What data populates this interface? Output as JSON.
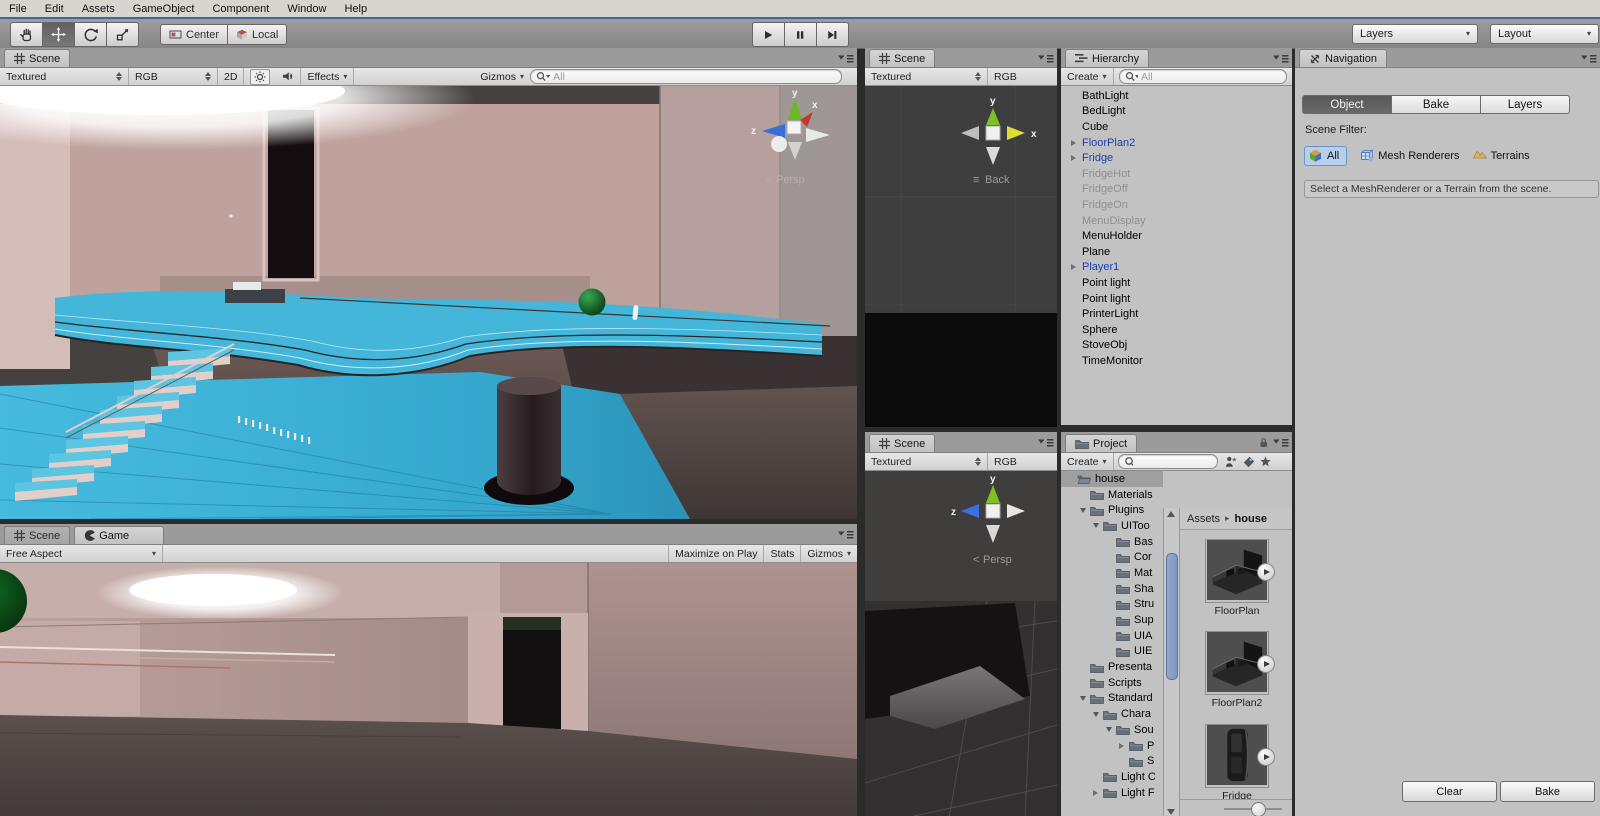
{
  "menu": {
    "items": [
      "File",
      "Edit",
      "Assets",
      "GameObject",
      "Component",
      "Window",
      "Help"
    ]
  },
  "toolbar": {
    "center": "Center",
    "local": "Local",
    "layers": "Layers",
    "layout": "Layout"
  },
  "scene_main": {
    "tab": "Scene",
    "shading": "Textured",
    "channel": "RGB",
    "btn_2d": "2D",
    "effects": "Effects",
    "gizmos": "Gizmos",
    "search_placeholder": "All",
    "view_label": "Persp",
    "view_icon": "<",
    "axis": {
      "x": "x",
      "y": "y",
      "z": "z"
    }
  },
  "scene_back": {
    "tab": "Scene",
    "shading": "Textured",
    "channel": "RGB",
    "view_label": "Back",
    "view_icon": "≡",
    "axis": {
      "x": "x",
      "y": "y"
    }
  },
  "scene_persp": {
    "tab": "Scene",
    "shading": "Textured",
    "channel": "RGB",
    "view_label": "Persp",
    "view_icon": "<",
    "axis": {
      "y": "y",
      "z": "z"
    }
  },
  "game": {
    "tab_scene": "Scene",
    "tab_game": "Game",
    "aspect": "Free Aspect",
    "maximize": "Maximize on Play",
    "stats": "Stats",
    "gizmos": "Gizmos"
  },
  "hierarchy": {
    "tab": "Hierarchy",
    "create": "Create",
    "search_placeholder": "All",
    "items": [
      {
        "label": "BathLight",
        "state": "normal"
      },
      {
        "label": "BedLight",
        "state": "normal"
      },
      {
        "label": "Cube",
        "state": "normal"
      },
      {
        "label": "FloorPlan2",
        "state": "prefab",
        "expand": true
      },
      {
        "label": "Fridge",
        "state": "prefab",
        "expand": true
      },
      {
        "label": "FridgeHot",
        "state": "disabled"
      },
      {
        "label": "FridgeOff",
        "state": "disabled"
      },
      {
        "label": "FridgeOn",
        "state": "disabled"
      },
      {
        "label": "MenuDisplay",
        "state": "disabled"
      },
      {
        "label": "MenuHolder",
        "state": "normal"
      },
      {
        "label": "Plane",
        "state": "normal"
      },
      {
        "label": "Player1",
        "state": "prefab",
        "expand": true
      },
      {
        "label": "Point light",
        "state": "normal"
      },
      {
        "label": "Point light",
        "state": "normal"
      },
      {
        "label": "PrinterLight",
        "state": "normal"
      },
      {
        "label": "Sphere",
        "state": "normal"
      },
      {
        "label": "StoveObj",
        "state": "normal"
      },
      {
        "label": "TimeMonitor",
        "state": "normal"
      }
    ]
  },
  "project": {
    "tab": "Project",
    "create": "Create",
    "search_placeholder": "",
    "breadcrumb": {
      "root": "Assets",
      "sep": "▸",
      "current": "house"
    },
    "tree": [
      {
        "label": "house",
        "indent": 0,
        "folder": "open",
        "selected": true
      },
      {
        "label": "Materials",
        "indent": 1,
        "folder": "closed"
      },
      {
        "label": "Plugins",
        "indent": 1,
        "folder": "closed",
        "arrow": "open"
      },
      {
        "label": "UIToo",
        "indent": 2,
        "folder": "closed",
        "arrow": "open"
      },
      {
        "label": "Bas",
        "indent": 3,
        "folder": "closed"
      },
      {
        "label": "Cor",
        "indent": 3,
        "folder": "closed"
      },
      {
        "label": "Mat",
        "indent": 3,
        "folder": "closed"
      },
      {
        "label": "Sha",
        "indent": 3,
        "folder": "closed"
      },
      {
        "label": "Stru",
        "indent": 3,
        "folder": "closed"
      },
      {
        "label": "Sup",
        "indent": 3,
        "folder": "closed"
      },
      {
        "label": "UIA",
        "indent": 3,
        "folder": "closed"
      },
      {
        "label": "UIE",
        "indent": 3,
        "folder": "closed"
      },
      {
        "label": "Presenta",
        "indent": 1,
        "folder": "closed"
      },
      {
        "label": "Scripts",
        "indent": 1,
        "folder": "closed"
      },
      {
        "label": "Standard",
        "indent": 1,
        "folder": "closed",
        "arrow": "open"
      },
      {
        "label": "Chara",
        "indent": 2,
        "folder": "closed",
        "arrow": "open"
      },
      {
        "label": "Sou",
        "indent": 3,
        "folder": "closed",
        "arrow": "open"
      },
      {
        "label": "P",
        "indent": 4,
        "folder": "closed",
        "arrow": "closed"
      },
      {
        "label": "S",
        "indent": 4,
        "folder": "closed"
      },
      {
        "label": "Light C",
        "indent": 2,
        "folder": "closed"
      },
      {
        "label": "Light F",
        "indent": 2,
        "folder": "closed",
        "arrow": "closed"
      }
    ],
    "assets": [
      {
        "name": "FloorPlan",
        "kind": "floorplan"
      },
      {
        "name": "FloorPlan2",
        "kind": "floorplan"
      },
      {
        "name": "Fridge",
        "kind": "fridge"
      }
    ]
  },
  "navigation": {
    "tab": "Navigation",
    "tabs": [
      "Object",
      "Bake",
      "Layers"
    ],
    "active_tab": "Object",
    "scene_filter": "Scene Filter:",
    "filters": [
      {
        "label": "All",
        "active": true
      },
      {
        "label": "Mesh Renderers",
        "active": false
      },
      {
        "label": "Terrains",
        "active": false
      }
    ],
    "help": "Select a MeshRenderer or a Terrain from the scene.",
    "clear": "Clear",
    "bake": "Bake"
  }
}
